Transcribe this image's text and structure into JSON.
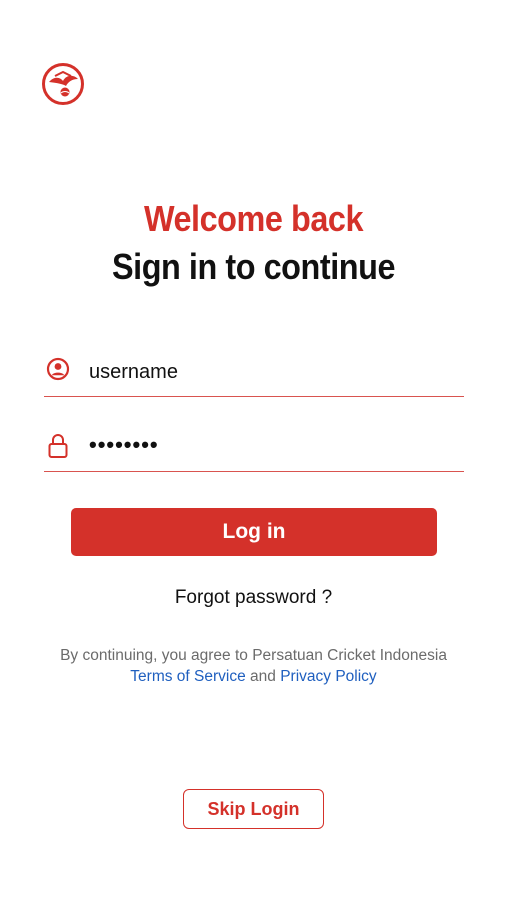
{
  "header": {
    "welcome": "Welcome back",
    "subtitle": "Sign in to continue"
  },
  "form": {
    "username_value": "username",
    "password_value": "••••••••",
    "login_label": "Log in",
    "forgot_label": "Forgot password ?"
  },
  "terms": {
    "prefix": "By continuing, you agree to Persatuan Cricket Indonesia",
    "tos_label": "Terms of Service",
    "and": "and",
    "privacy_label": "Privacy Policy"
  },
  "skip_label": "Skip Login",
  "colors": {
    "accent": "#d4312a",
    "link": "#1f5fbf"
  },
  "icons": {
    "logo": "cricket-association-logo",
    "username": "user-circle-icon",
    "password": "lock-icon"
  }
}
